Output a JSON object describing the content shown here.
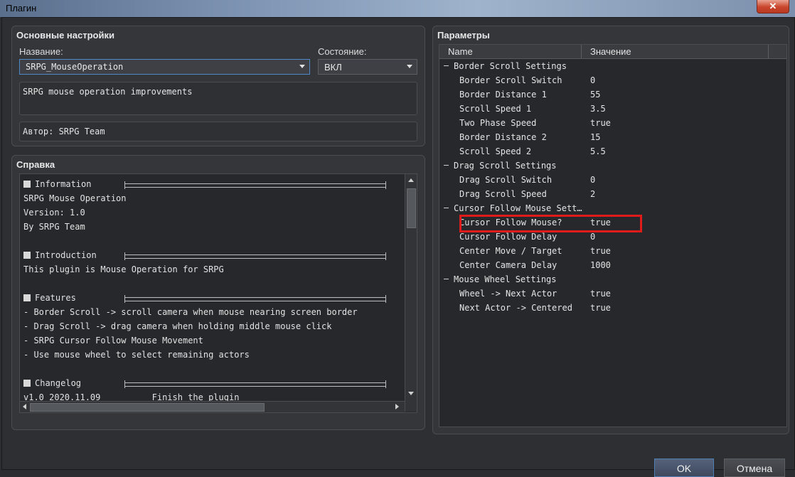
{
  "window": {
    "title": "Плагин",
    "close_glyph": "✕"
  },
  "basic": {
    "title": "Основные настройки",
    "name_label": "Название:",
    "name_value": "SRPG_MouseOperation",
    "state_label": "Состояние:",
    "state_value": "ВКЛ",
    "description": "SRPG mouse operation improvements",
    "author": "Автор: SRPG Team"
  },
  "help": {
    "title": "Справка",
    "lines": [
      {
        "text": "Information",
        "heading": true
      },
      {
        "text": "SRPG Mouse Operation"
      },
      {
        "text": "Version: 1.0"
      },
      {
        "text": "By SRPG Team"
      },
      {
        "text": ""
      },
      {
        "text": "Introduction",
        "heading": true
      },
      {
        "text": "This plugin is Mouse Operation for SRPG"
      },
      {
        "text": ""
      },
      {
        "text": "Features",
        "heading": true
      },
      {
        "text": "- Border Scroll -> scroll camera when mouse nearing screen border"
      },
      {
        "text": "- Drag Scroll -> drag camera when holding middle mouse click"
      },
      {
        "text": "- SRPG Cursor Follow Mouse Movement"
      },
      {
        "text": "- Use mouse wheel to select remaining actors"
      },
      {
        "text": ""
      },
      {
        "text": "Changelog",
        "heading": true
      },
      {
        "text": "v1.0 2020.11.09          Finish the plugin"
      }
    ]
  },
  "params": {
    "title": "Параметры",
    "col_name": "Name",
    "col_value": "Значение",
    "rows": [
      {
        "name": "Border Scroll Settings",
        "group": true
      },
      {
        "name": "Border Scroll Switch",
        "value": "0"
      },
      {
        "name": "Border Distance 1",
        "value": "55"
      },
      {
        "name": "Scroll Speed 1",
        "value": "3.5"
      },
      {
        "name": "Two Phase Speed",
        "value": "true"
      },
      {
        "name": "Border Distance 2",
        "value": "15"
      },
      {
        "name": "Scroll Speed 2",
        "value": "5.5"
      },
      {
        "name": "Drag Scroll Settings",
        "group": true
      },
      {
        "name": "Drag Scroll Switch",
        "value": "0"
      },
      {
        "name": "Drag Scroll Speed",
        "value": "2"
      },
      {
        "name": "Cursor Follow Mouse Sett…",
        "group": true
      },
      {
        "name": "Cursor Follow Mouse?",
        "value": "true"
      },
      {
        "name": "Cursor Follow Delay",
        "value": "0"
      },
      {
        "name": "Center Move / Target",
        "value": "true"
      },
      {
        "name": "Center Camera Delay",
        "value": "1000"
      },
      {
        "name": "Mouse Wheel Settings",
        "group": true
      },
      {
        "name": "Wheel -> Next Actor",
        "value": "true"
      },
      {
        "name": "Next Actor -> Centered",
        "value": "true"
      }
    ]
  },
  "buttons": {
    "ok": "OK",
    "cancel": "Отмена"
  },
  "colors": {
    "highlight": "#e11a1a",
    "accent": "#4f88c6"
  }
}
